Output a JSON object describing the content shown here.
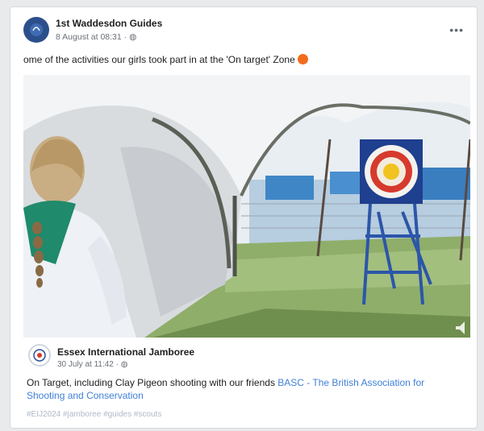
{
  "post": {
    "author": "1st Waddesdon Guides",
    "meta": "8 August at 08:31 · ",
    "more_icon": "more-dots-icon",
    "caption": "ome of the activities our girls took part in at the 'On target' Zone"
  },
  "shared": {
    "author": "Essex International Jamboree",
    "meta": "30 July at 11:42 · ",
    "text_before_link": "On Target, including Clay Pigeon shooting with our friends ",
    "link_text": "BASC - The British Association for Shooting and Conservation",
    "tags": "#EIJ2024 #jamboree #guides #scouts"
  }
}
